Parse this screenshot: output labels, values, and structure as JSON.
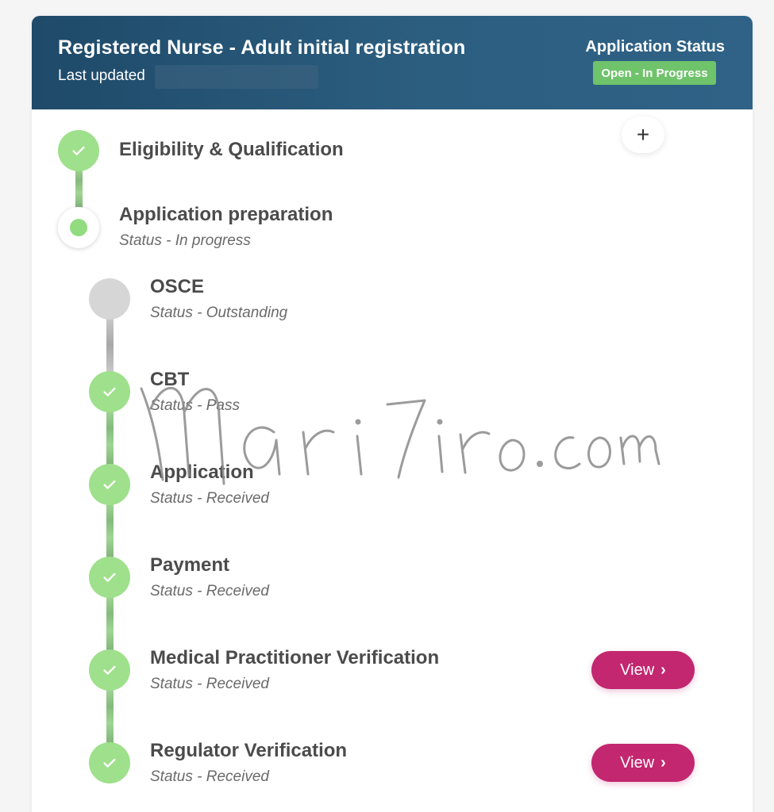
{
  "header": {
    "title": "Registered Nurse - Adult initial registration",
    "last_updated_label": "Last updated",
    "status_label": "Application Status",
    "status_badge": "Open - In Progress"
  },
  "top_steps": [
    {
      "title": "Eligibility & Qualification",
      "state": "complete"
    },
    {
      "title": "Application preparation",
      "status": "Status - In progress",
      "state": "current"
    }
  ],
  "expand_button": "+",
  "sub_steps": [
    {
      "title": "OSCE",
      "status": "Status - Outstanding",
      "state": "pending"
    },
    {
      "title": "CBT",
      "status": "Status - Pass",
      "state": "complete"
    },
    {
      "title": "Application",
      "status": "Status - Received",
      "state": "complete"
    },
    {
      "title": "Payment",
      "status": "Status - Received",
      "state": "complete"
    },
    {
      "title": "Medical Practitioner Verification",
      "status": "Status - Received",
      "state": "complete",
      "action": "View"
    },
    {
      "title": "Regulator Verification",
      "status": "Status - Received",
      "state": "complete",
      "action": "View"
    }
  ],
  "watermark": "mari7iro.com",
  "colors": {
    "header_bg": "#2c5e80",
    "status_badge": "#6fc36b",
    "complete_node": "#9ee08b",
    "pending_node": "#d6d6d6",
    "view_button": "#c2276f"
  },
  "icons": {
    "complete": "check-icon",
    "current": "dot-icon",
    "action": "chevron-right-icon"
  }
}
